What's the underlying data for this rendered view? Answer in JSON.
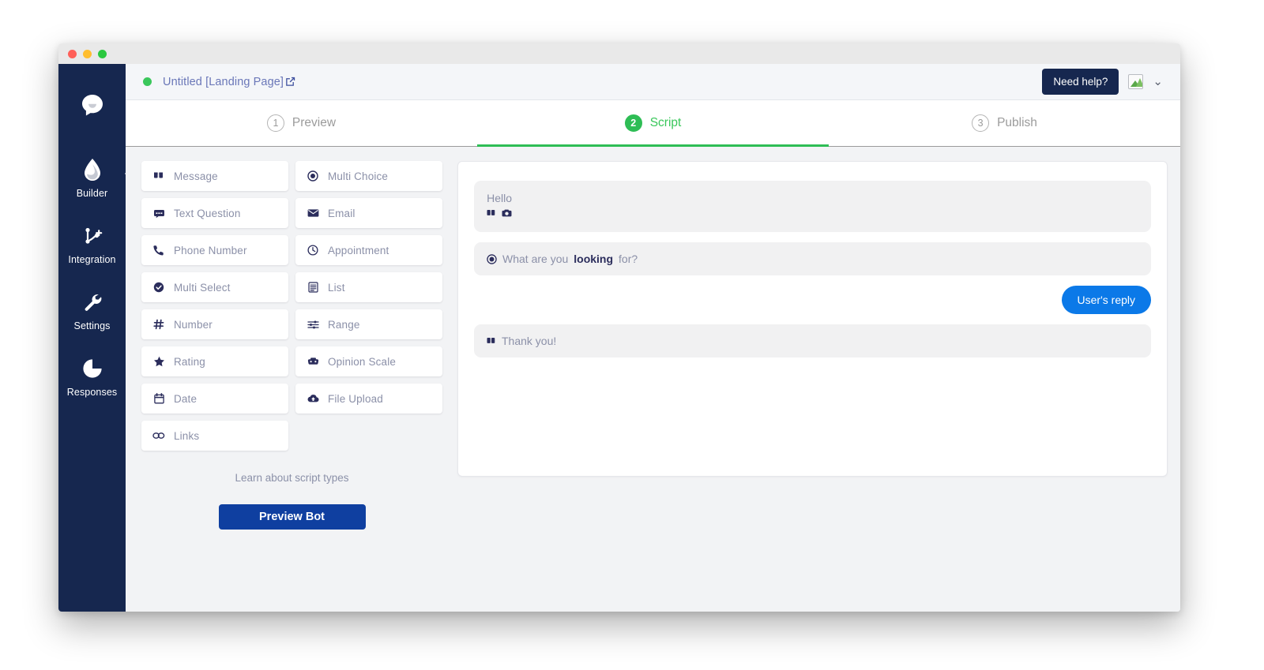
{
  "window": {
    "traffic_lights": [
      "close",
      "minimize",
      "maximize"
    ]
  },
  "topbar": {
    "status": "online",
    "title": "Untitled [Landing Page]",
    "external_link_icon": "external-link-icon",
    "need_help_label": "Need help?",
    "avatar_icon": "broken-image-icon",
    "chevron": "⌄"
  },
  "sidebar": {
    "logo_icon": "chat-bubble-logo-icon",
    "items": [
      {
        "label": "Builder",
        "icon": "water-drop-icon",
        "active": true
      },
      {
        "label": "Integration",
        "icon": "integration-branch-icon",
        "active": false
      },
      {
        "label": "Settings",
        "icon": "wrench-icon",
        "active": false
      },
      {
        "label": "Responses",
        "icon": "pie-chart-icon",
        "active": false
      }
    ]
  },
  "tabs": [
    {
      "number": "1",
      "label": "Preview",
      "active": false
    },
    {
      "number": "2",
      "label": "Script",
      "active": true
    },
    {
      "number": "3",
      "label": "Publish",
      "active": false
    }
  ],
  "script_types": [
    {
      "label": "Message",
      "icon": "quote-icon"
    },
    {
      "label": "Multi Choice",
      "icon": "radio-filled-icon"
    },
    {
      "label": "Text Question",
      "icon": "comment-icon"
    },
    {
      "label": "Email",
      "icon": "envelope-icon"
    },
    {
      "label": "Phone Number",
      "icon": "phone-icon"
    },
    {
      "label": "Appointment",
      "icon": "clock-icon"
    },
    {
      "label": "Multi Select",
      "icon": "check-circle-icon"
    },
    {
      "label": "List",
      "icon": "list-document-icon"
    },
    {
      "label": "Number",
      "icon": "hash-icon"
    },
    {
      "label": "Range",
      "icon": "sliders-icon"
    },
    {
      "label": "Rating",
      "icon": "star-icon"
    },
    {
      "label": "Opinion Scale",
      "icon": "smiley-mask-icon"
    },
    {
      "label": "Date",
      "icon": "calendar-icon"
    },
    {
      "label": "File Upload",
      "icon": "cloud-upload-icon"
    },
    {
      "label": "Links",
      "icon": "link-chain-icon"
    }
  ],
  "left_panel": {
    "learn_link": "Learn about script types",
    "preview_button": "Preview Bot"
  },
  "script": {
    "messages": [
      {
        "kind": "bot",
        "text": "Hello",
        "icons": [
          "quote-icon",
          "camera-icon"
        ]
      },
      {
        "kind": "bot",
        "icon": "radio-filled-icon",
        "text_before": "What are you ",
        "text_bold": "looking",
        "text_after": " for?"
      },
      {
        "kind": "user",
        "text": "User's reply"
      },
      {
        "kind": "bot",
        "icon": "quote-icon",
        "text": "Thank you!"
      }
    ]
  },
  "colors": {
    "nav_background": "#16274f",
    "accent_green": "#2ebd55",
    "accent_blue": "#0b79e8",
    "primary_button": "#0f3fa0",
    "bubble_gray": "#f1f1f2",
    "muted_text": "#8b90a8",
    "dark_text": "#2b2d5c"
  }
}
